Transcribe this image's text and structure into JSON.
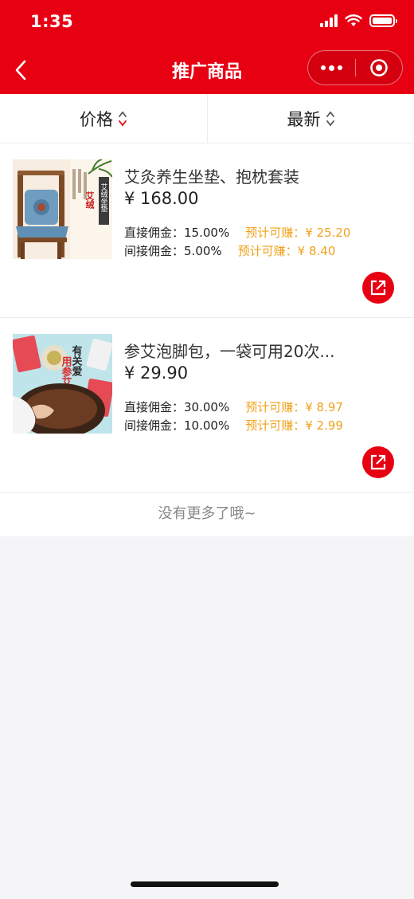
{
  "status_bar": {
    "time": "1:35"
  },
  "nav": {
    "title": "推广商品"
  },
  "sort": {
    "price_label": "价格",
    "latest_label": "最新"
  },
  "products": [
    {
      "name": "艾灸养生坐垫、抱枕套装",
      "price": "¥ 168.00",
      "direct_label": "直接佣金：",
      "direct_rate": "15.00%",
      "direct_est": "预计可赚：¥ 25.20",
      "indirect_label": "间接佣金：",
      "indirect_rate": "5.00%",
      "indirect_est": "预计可赚：¥ 8.40",
      "image_text": [
        "艾绒",
        "艾绒坐垫"
      ]
    },
    {
      "name": "参艾泡脚包，一袋可用20次...",
      "price": "¥ 29.90",
      "direct_label": "直接佣金：",
      "direct_rate": "30.00%",
      "direct_est": "预计可赚：¥ 8.97",
      "indirect_label": "间接佣金：",
      "indirect_rate": "10.00%",
      "indirect_est": "预计可赚：¥ 2.99",
      "image_text": [
        "有关爱",
        "用参艾"
      ]
    }
  ],
  "footer": {
    "no_more": "没有更多了哦~"
  },
  "colors": {
    "brand": "#e60012",
    "estimate": "#f0a21c"
  }
}
